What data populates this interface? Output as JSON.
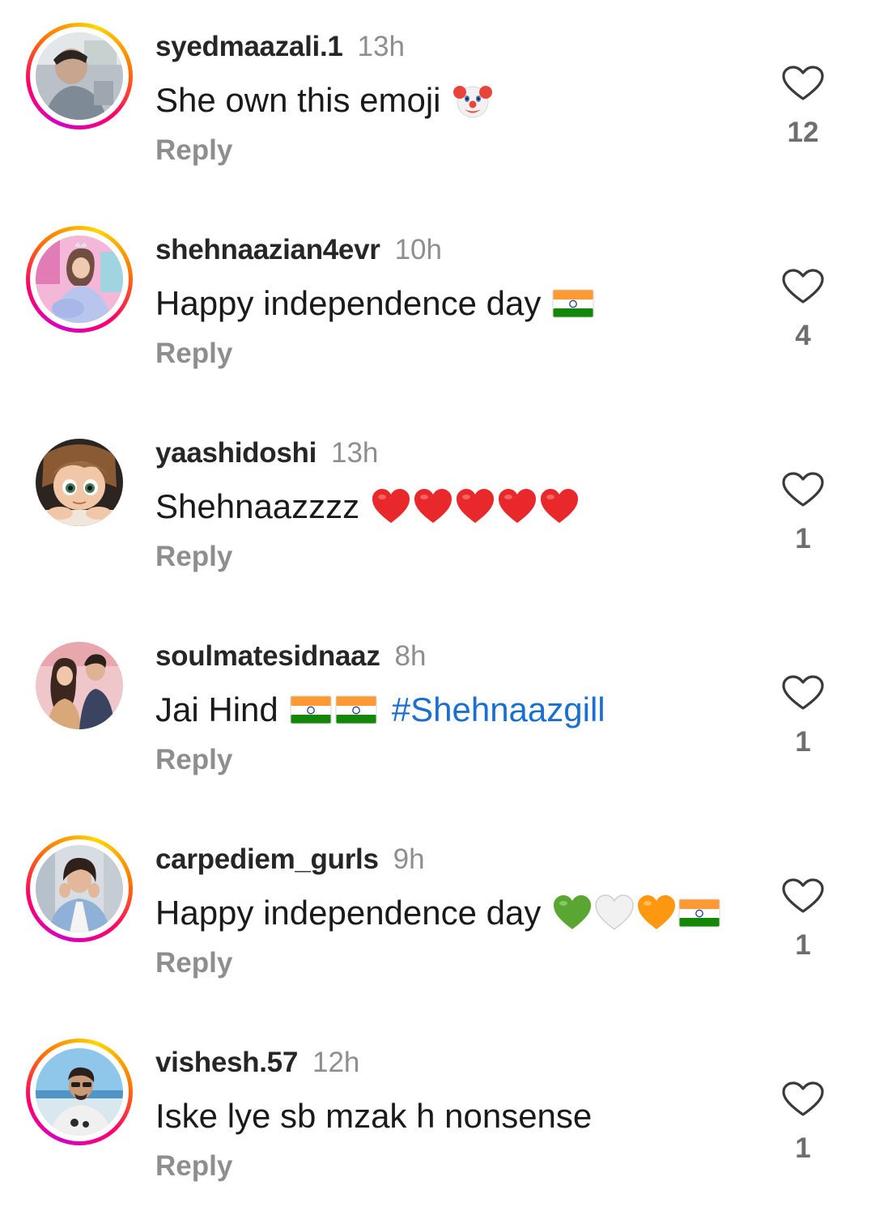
{
  "reply_label": "Reply",
  "comments": [
    {
      "username": "syedmaazali.1",
      "time": "13h",
      "text": "She own this emoji",
      "emojis": [
        "clown-face"
      ],
      "likes": "12",
      "story_ring": true
    },
    {
      "username": "shehnaazian4evr",
      "time": "10h",
      "text": "Happy independence day",
      "emojis": [
        "india-flag"
      ],
      "likes": "4",
      "story_ring": true
    },
    {
      "username": "yaashidoshi",
      "time": "13h",
      "text": "Shehnaazzzz",
      "emojis": [
        "red-heart",
        "red-heart",
        "red-heart",
        "red-heart",
        "red-heart"
      ],
      "likes": "1",
      "story_ring": false
    },
    {
      "username": "soulmatesidnaaz",
      "time": "8h",
      "text": "Jai Hind",
      "emojis": [
        "india-flag",
        "india-flag"
      ],
      "hashtag": "#Shehnaazgill",
      "likes": "1",
      "story_ring": false
    },
    {
      "username": "carpediem_gurls",
      "time": "9h",
      "text": "Happy independence day",
      "emojis": [
        "green-heart",
        "white-heart",
        "orange-heart",
        "india-flag"
      ],
      "likes": "1",
      "story_ring": true
    },
    {
      "username": "vishesh.57",
      "time": "12h",
      "text": "Iske lye sb mzak h nonsense",
      "emojis": [],
      "likes": "1",
      "story_ring": true
    }
  ],
  "colors": {
    "hashtag": "#1a6fd1",
    "meta_gray": "#8e8e8e",
    "text": "#1a1a1a"
  }
}
